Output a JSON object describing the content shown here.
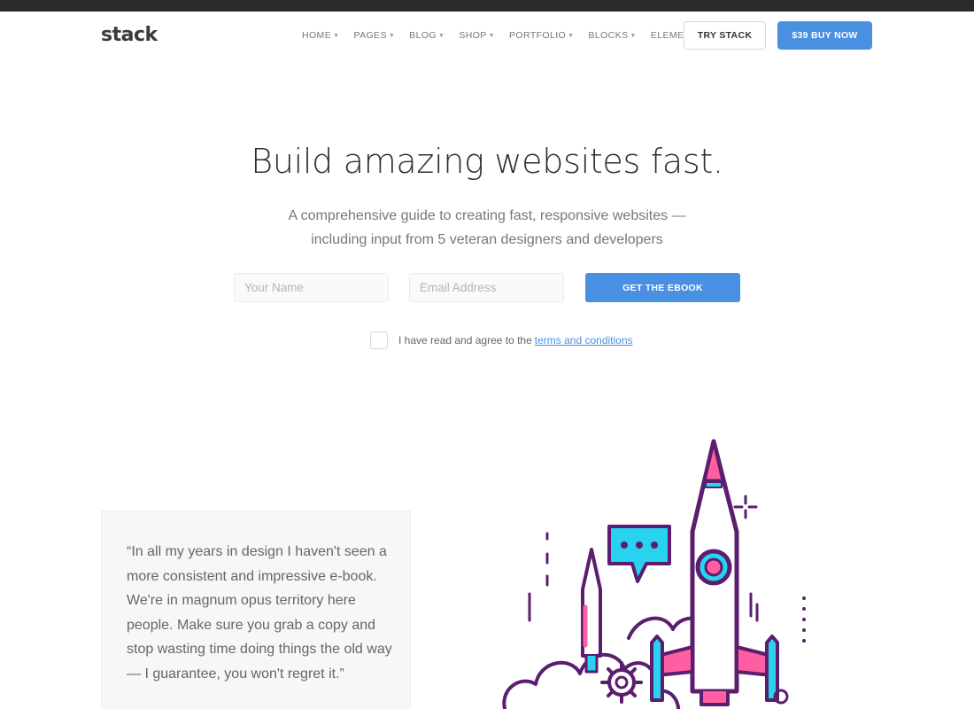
{
  "nav": {
    "logo": "stack",
    "menu": [
      {
        "label": "HOME"
      },
      {
        "label": "PAGES"
      },
      {
        "label": "BLOG"
      },
      {
        "label": "SHOP"
      },
      {
        "label": "PORTFOLIO"
      },
      {
        "label": "BLOCKS"
      },
      {
        "label": "ELEMENTS"
      }
    ],
    "try_label": "TRY STACK",
    "buy_label": "$39 BUY NOW"
  },
  "hero": {
    "title": "Build amazing websites fast.",
    "subtitle": "A comprehensive guide to creating fast, responsive websites — including input from 5 veteran designers and developers"
  },
  "form": {
    "name_placeholder": "Your Name",
    "email_placeholder": "Email Address",
    "submit_label": "GET THE EBOOK",
    "agree_text": "I have read and agree to the",
    "terms_link": "terms and conditions"
  },
  "testimonial": {
    "quote": "“In all my years in design I haven't seen a more consistent and impressive e-book. We're in magnum opus territory here people. Make sure you grab a copy and stop wasting time doing things the old way — I guarantee, you won't regret it.”"
  },
  "icons": {
    "illustration": "rocket-launch-illustration"
  },
  "colors": {
    "accent": "#4a90e2",
    "illustration_purple": "#5b1e6e",
    "illustration_pink": "#ff5fa2",
    "illustration_cyan": "#29d3f0"
  }
}
